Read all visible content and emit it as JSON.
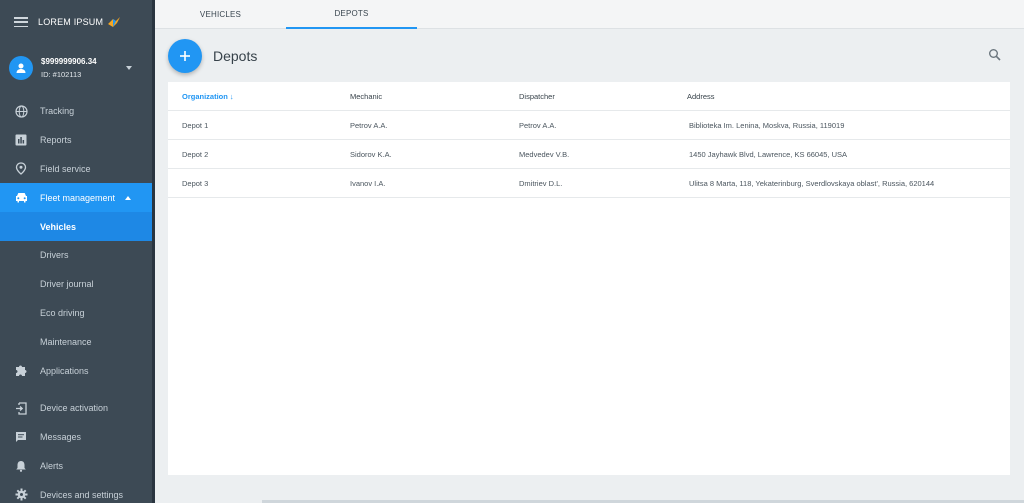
{
  "brand": {
    "name": "LOREM IPSUM"
  },
  "account": {
    "balance": "$999999906.34",
    "id": "ID: #102113"
  },
  "nav": {
    "tracking": "Tracking",
    "reports": "Reports",
    "field_service": "Field service",
    "fleet_management": "Fleet management",
    "vehicles": "Vehicles",
    "drivers": "Drivers",
    "driver_journal": "Driver journal",
    "eco_driving": "Eco driving",
    "maintenance": "Maintenance",
    "applications": "Applications",
    "device_activation": "Device activation",
    "messages": "Messages",
    "alerts": "Alerts",
    "devices_settings": "Devices and settings"
  },
  "tabs": [
    "VEHICLES",
    "DEPOTS"
  ],
  "page": {
    "title": "Depots"
  },
  "table": {
    "columns": [
      "Organization ↓",
      "Mechanic",
      "Dispatcher",
      "Address"
    ],
    "rows": [
      [
        "Depot 1",
        "Petrov A.A.",
        "Petrov A.A.",
        "Biblioteka Im. Lenina, Moskva, Russia, 119019"
      ],
      [
        "Depot 2",
        "Sidorov K.A.",
        "Medvedev V.B.",
        "1450 Jayhawk Blvd, Lawrence, KS 66045, USA"
      ],
      [
        "Depot 3",
        "Ivanov I.A.",
        "Dmitriev D.L.",
        "Ulitsa 8 Marta, 118, Yekaterinburg, Sverdlovskaya oblast', Russia, 620144"
      ]
    ]
  },
  "colors": {
    "accent": "#2196f3",
    "sidebar": "#3d4a55"
  }
}
